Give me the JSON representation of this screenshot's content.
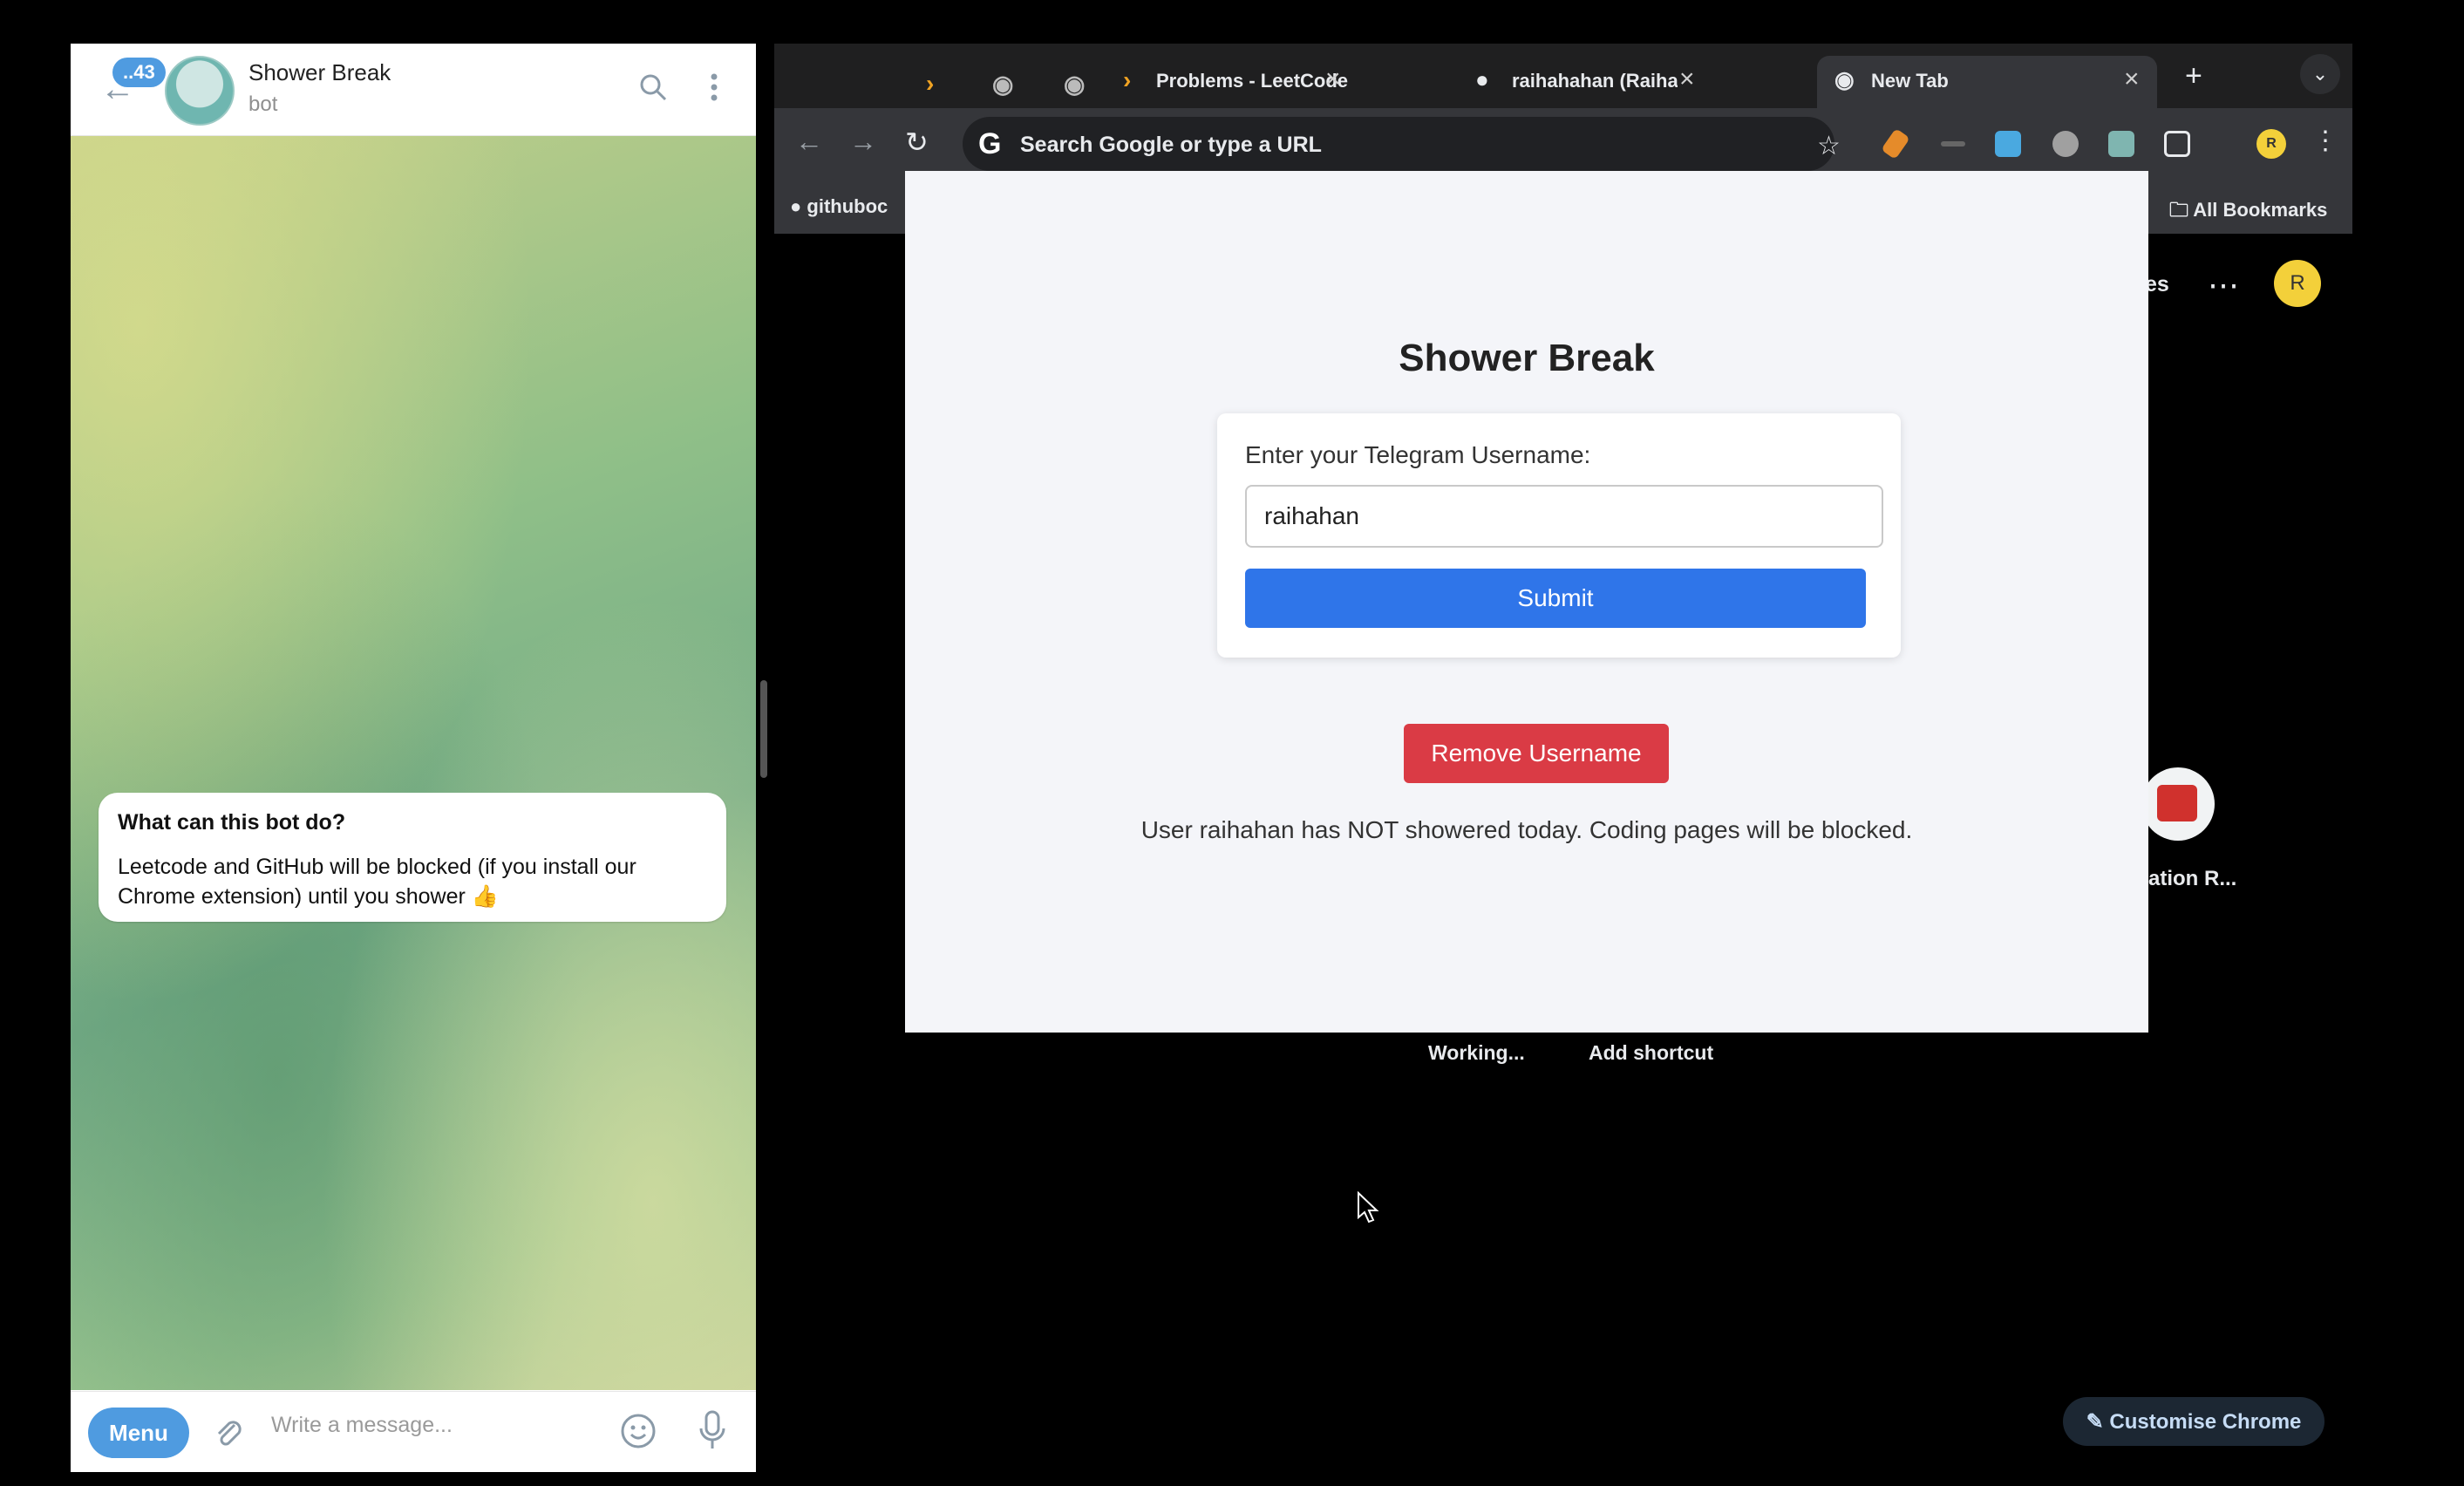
{
  "telegram": {
    "unread_badge": "..43",
    "chat_title": "Shower Break",
    "chat_subtitle": "bot",
    "bubble_title": "What can this bot do?",
    "bubble_text": "Leetcode and GitHub will be blocked (if you install our Chrome extension) until you shower 👍",
    "menu_label": "Menu",
    "message_placeholder": "Write a message..."
  },
  "chrome": {
    "tabs": [
      {
        "title": "",
        "icon": "leetcode-icon"
      },
      {
        "title": "",
        "icon": "globe-icon"
      },
      {
        "title": "",
        "icon": "globe-icon"
      },
      {
        "title": "Problems - LeetCode",
        "icon": "leetcode-icon"
      },
      {
        "title": "raihahahan (Raihan Rizqulla",
        "icon": "github-icon"
      },
      {
        "title": "New Tab",
        "icon": "chrome-icon",
        "active": true
      }
    ],
    "omnibox_text": "Search Google or type a URL",
    "bookmark_github": "githuboc",
    "all_bookmarks": "All Bookmarks",
    "profile_initial": "R",
    "ntp": {
      "partial_label": "es",
      "shortcut_label": "ation R...",
      "working": "Working...",
      "add_shortcut": "Add shortcut",
      "customise": "Customise Chrome"
    }
  },
  "popup": {
    "title": "Shower Break",
    "label": "Enter your Telegram Username:",
    "username_value": "raihahan",
    "submit_label": "Submit",
    "remove_label": "Remove Username",
    "status": "User raihahan has NOT showered today. Coding pages will be blocked."
  },
  "colors": {
    "submit": "#2f75e9",
    "remove": "#da3b45",
    "telegram_accent": "#4f9be0",
    "profile": "#f3d03a"
  }
}
